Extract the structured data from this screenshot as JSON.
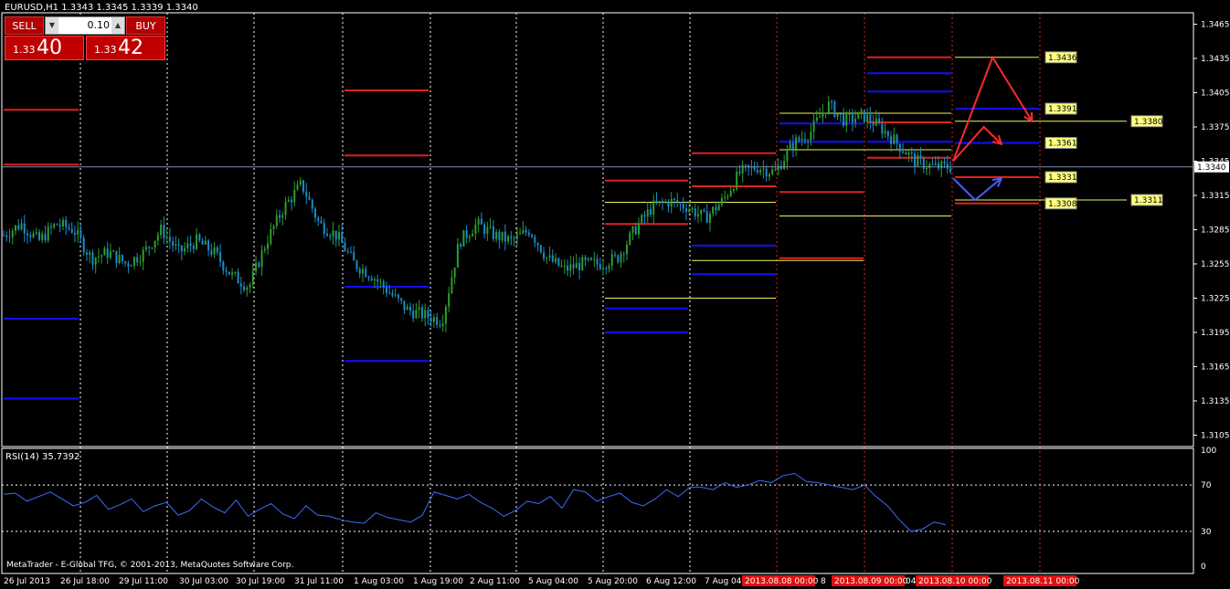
{
  "window": {
    "title": "EURUSD,H1  1.3343 1.3345 1.3339 1.3340"
  },
  "trade_panel": {
    "sell_label": "SELL",
    "buy_label": "BUY",
    "lot_value": "0.10",
    "sell_small": "1.33",
    "sell_big": "40",
    "buy_small": "1.33",
    "buy_big": "42"
  },
  "footer": {
    "copyright": "MetaTrader - E-Global TFG, © 2001-2013, MetaQuotes Software Corp."
  },
  "indicator": {
    "label": "RSI(14) 35.7392"
  },
  "colors": {
    "bull": "#2e9e2e",
    "bear": "#1a8ccc",
    "red": "#e02020",
    "blue": "#1010ff",
    "yellow": "#f2f25a",
    "grid": "#ffffff"
  },
  "chart_data": [
    {
      "type": "candlestick",
      "symbol": "EURUSD",
      "timeframe": "H1",
      "ylim": [
        1.3095,
        1.3475
      ],
      "y_ticks": [
        "1.3465",
        "1.3435",
        "1.3405",
        "1.3375",
        "1.3345",
        "1.3315",
        "1.3285",
        "1.3255",
        "1.3225",
        "1.3195",
        "1.3165",
        "1.3135",
        "1.3105"
      ],
      "current_price": "1.3340",
      "x_tick_labels": [
        "26 Jul 2013",
        "26 Jul 18:00",
        "29 Jul 11:00",
        "30 Jul 03:00",
        "30 Jul 19:00",
        "31 Jul 11:00",
        "1 Aug 03:00",
        "1 Aug 19:00",
        "2 Aug 11:00",
        "5 Aug 04:00",
        "5 Aug 20:00",
        "6 Aug 12:00",
        "7 Aug 04:00",
        "8"
      ],
      "future_date_labels": [
        "2013.08.08 00:00",
        "2013.08.09 00:00",
        "04:",
        "2013.08.10 00:00",
        "2013.08.11 00:00"
      ],
      "price_labels": [
        "1.3436",
        "1.3391",
        "1.3380",
        "1.3361",
        "1.3331",
        "1.3311",
        "1.3308"
      ],
      "close_path": [
        1.328,
        1.329,
        1.3275,
        1.329,
        1.3285,
        1.326,
        1.3265,
        1.3255,
        1.3265,
        1.3285,
        1.3265,
        1.3275,
        1.3265,
        1.3245,
        1.3235,
        1.3275,
        1.3305,
        1.3325,
        1.329,
        1.328,
        1.3255,
        1.3245,
        1.323,
        1.3215,
        1.321,
        1.3205,
        1.3275,
        1.329,
        1.328,
        1.3275,
        1.3285,
        1.326,
        1.325,
        1.3255,
        1.3255,
        1.326,
        1.3285,
        1.3305,
        1.331,
        1.3305,
        1.3295,
        1.331,
        1.3335,
        1.334,
        1.3335,
        1.336,
        1.337,
        1.3395,
        1.338,
        1.3385,
        1.3375,
        1.336,
        1.3345,
        1.334,
        1.334
      ],
      "levels": [
        {
          "color": "red",
          "y": 1.339,
          "x_from": 0,
          "x_to": 1
        },
        {
          "color": "red",
          "y": 1.3342,
          "x_from": 0,
          "x_to": 1
        },
        {
          "color": "blue",
          "y": 1.3207,
          "x_from": 0,
          "x_to": 1
        },
        {
          "color": "blue",
          "y": 1.3137,
          "x_from": 0,
          "x_to": 1
        },
        {
          "color": "red",
          "y": 1.3407,
          "x_from": 4,
          "x_to": 5
        },
        {
          "color": "red",
          "y": 1.335,
          "x_from": 4,
          "x_to": 5
        },
        {
          "color": "blue",
          "y": 1.3235,
          "x_from": 4,
          "x_to": 5
        },
        {
          "color": "blue",
          "y": 1.317,
          "x_from": 4,
          "x_to": 5
        },
        {
          "color": "red",
          "y": 1.3328,
          "x_from": 7,
          "x_to": 8
        },
        {
          "color": "red",
          "y": 1.329,
          "x_from": 7,
          "x_to": 8
        },
        {
          "color": "yellow",
          "y": 1.3309,
          "x_from": 7,
          "x_to": 9
        },
        {
          "color": "yellow",
          "y": 1.3225,
          "x_from": 7,
          "x_to": 9
        },
        {
          "color": "blue",
          "y": 1.3216,
          "x_from": 7,
          "x_to": 8
        },
        {
          "color": "blue",
          "y": 1.3195,
          "x_from": 7,
          "x_to": 8
        },
        {
          "color": "red",
          "y": 1.3352,
          "x_from": 8,
          "x_to": 9
        },
        {
          "color": "red",
          "y": 1.3323,
          "x_from": 8,
          "x_to": 9
        },
        {
          "color": "blue",
          "y": 1.3271,
          "x_from": 8,
          "x_to": 9
        },
        {
          "color": "blue",
          "y": 1.3246,
          "x_from": 8,
          "x_to": 9
        },
        {
          "color": "yellow",
          "y": 1.3258,
          "x_from": 8,
          "x_to": 10
        },
        {
          "color": "red",
          "y": 1.3318,
          "x_from": 9,
          "x_to": 10
        },
        {
          "color": "red",
          "y": 1.326,
          "x_from": 9,
          "x_to": 10
        },
        {
          "color": "blue",
          "y": 1.3378,
          "x_from": 9,
          "x_to": 10
        },
        {
          "color": "blue",
          "y": 1.3362,
          "x_from": 9,
          "x_to": 10
        },
        {
          "color": "yellow",
          "y": 1.3387,
          "x_from": 9,
          "x_to": 11
        },
        {
          "color": "yellow",
          "y": 1.3355,
          "x_from": 9,
          "x_to": 11
        },
        {
          "color": "yellow",
          "y": 1.3297,
          "x_from": 9,
          "x_to": 11
        },
        {
          "color": "red",
          "y": 1.3436,
          "x_from": 10,
          "x_to": 11
        },
        {
          "color": "red",
          "y": 1.3379,
          "x_from": 10,
          "x_to": 11
        },
        {
          "color": "red",
          "y": 1.3348,
          "x_from": 10,
          "x_to": 11
        },
        {
          "color": "blue",
          "y": 1.3422,
          "x_from": 10,
          "x_to": 11
        },
        {
          "color": "blue",
          "y": 1.3406,
          "x_from": 10,
          "x_to": 11
        },
        {
          "color": "blue",
          "y": 1.3362,
          "x_from": 10,
          "x_to": 11
        },
        {
          "color": "red",
          "y": 1.3331,
          "x_from": 11,
          "x_to": 12
        },
        {
          "color": "red",
          "y": 1.3308,
          "x_from": 11,
          "x_to": 12
        },
        {
          "color": "blue",
          "y": 1.3391,
          "x_from": 11,
          "x_to": 12
        },
        {
          "color": "blue",
          "y": 1.3361,
          "x_from": 11,
          "x_to": 12
        },
        {
          "color": "yellow",
          "y": 1.3436,
          "x_from": 11,
          "x_to": 12
        },
        {
          "color": "yellow",
          "y": 1.338,
          "x_from": 11,
          "x_to": 13
        },
        {
          "color": "yellow",
          "y": 1.3311,
          "x_from": 11,
          "x_to": 13
        }
      ],
      "arrows": [
        {
          "color": "red",
          "points": [
            [
              0.0,
              1.3345
            ],
            [
              0.45,
              1.3436
            ],
            [
              0.9,
              1.338
            ]
          ]
        },
        {
          "color": "red",
          "points": [
            [
              0.0,
              1.3345
            ],
            [
              0.35,
              1.3375
            ],
            [
              0.55,
              1.336
            ]
          ]
        },
        {
          "color": "blue",
          "points": [
            [
              0.0,
              1.333
            ],
            [
              0.25,
              1.3311
            ],
            [
              0.55,
              1.333
            ]
          ]
        }
      ],
      "rsi": {
        "label": "RSI(14) 35.7392",
        "ylim": [
          0,
          100
        ],
        "ticks": [
          "100",
          "70",
          "30",
          "0"
        ],
        "values": [
          62,
          63,
          56,
          60,
          64,
          58,
          52,
          55,
          61,
          49,
          53,
          58,
          47,
          52,
          55,
          44,
          48,
          58,
          51,
          46,
          57,
          43,
          49,
          54,
          45,
          41,
          52,
          44,
          43,
          40,
          38,
          37,
          46,
          42,
          40,
          38,
          44,
          64,
          61,
          58,
          62,
          55,
          50,
          43,
          48,
          56,
          54,
          60,
          50,
          66,
          64,
          56,
          60,
          63,
          55,
          52,
          58,
          66,
          60,
          68,
          68,
          66,
          72,
          68,
          70,
          74,
          72,
          78,
          80,
          73,
          72,
          70,
          68,
          66,
          70,
          60,
          52,
          40,
          30,
          32,
          38,
          35.7
        ]
      }
    }
  ]
}
